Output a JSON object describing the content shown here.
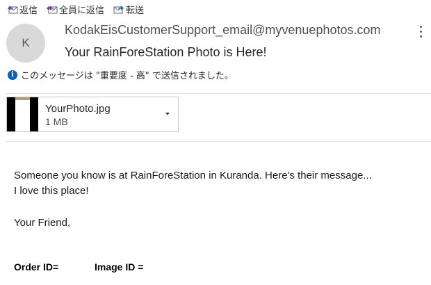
{
  "toolbar": {
    "reply_label": "返信",
    "reply_all_label": "全員に返信",
    "forward_label": "転送",
    "reply_icon": "reply-icon",
    "reply_all_icon": "reply-all-icon",
    "forward_icon": "forward-icon"
  },
  "header": {
    "avatar_initial": "K",
    "sender": "KodakEisCustomerSupport_email@myvenuephotos.com",
    "subject": "Your RainForeStation Photo is Here!",
    "importance_notice": "このメッセージは \"重要度 - 高\" で送信されました。"
  },
  "attachment": {
    "file_name": "YourPhoto.jpg",
    "file_size": "1 MB"
  },
  "body": {
    "line1": "Someone you know is at RainForeStation in Kuranda. Here's their message...",
    "line2": "I love this place!",
    "signoff": "Your Friend,",
    "order_id_label": "Order ID=",
    "image_id_label": "Image ID ="
  },
  "colors": {
    "accent_blue": "#0b5fb4",
    "avatar_bg": "#d9d9d9",
    "text": "#262626"
  }
}
